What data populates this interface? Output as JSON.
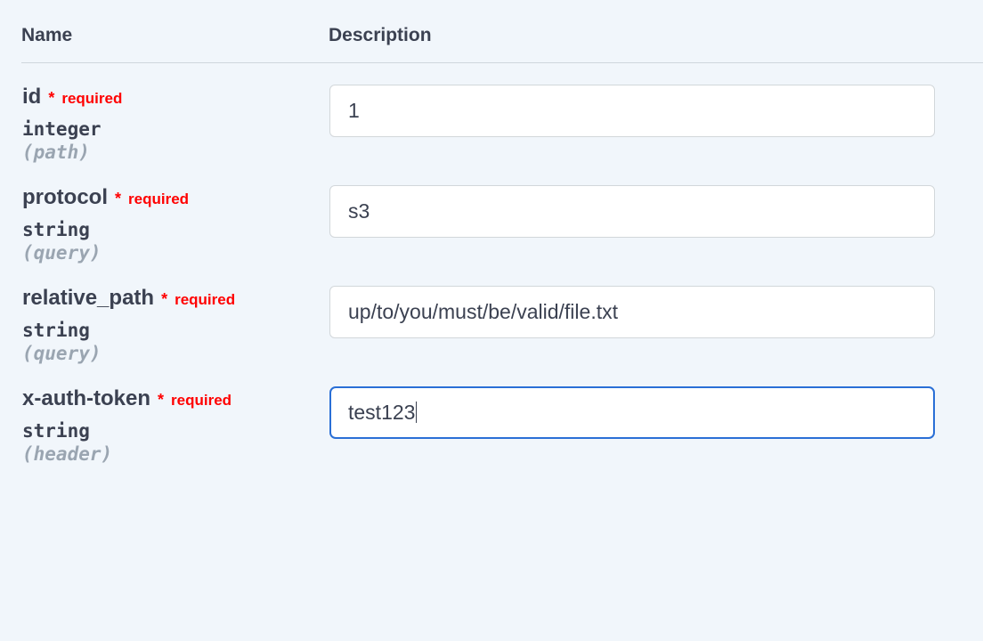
{
  "headers": {
    "name": "Name",
    "description": "Description"
  },
  "required_label": "required",
  "params": [
    {
      "name": "id",
      "type": "integer",
      "in": "(path)",
      "required": true,
      "value": "1",
      "focused": false
    },
    {
      "name": "protocol",
      "type": "string",
      "in": "(query)",
      "required": true,
      "value": "s3",
      "focused": false
    },
    {
      "name": "relative_path",
      "type": "string",
      "in": "(query)",
      "required": true,
      "value": "up/to/you/must/be/valid/file.txt",
      "focused": false
    },
    {
      "name": "x-auth-token",
      "type": "string",
      "in": "(header)",
      "required": true,
      "value": "test123",
      "focused": true
    }
  ]
}
